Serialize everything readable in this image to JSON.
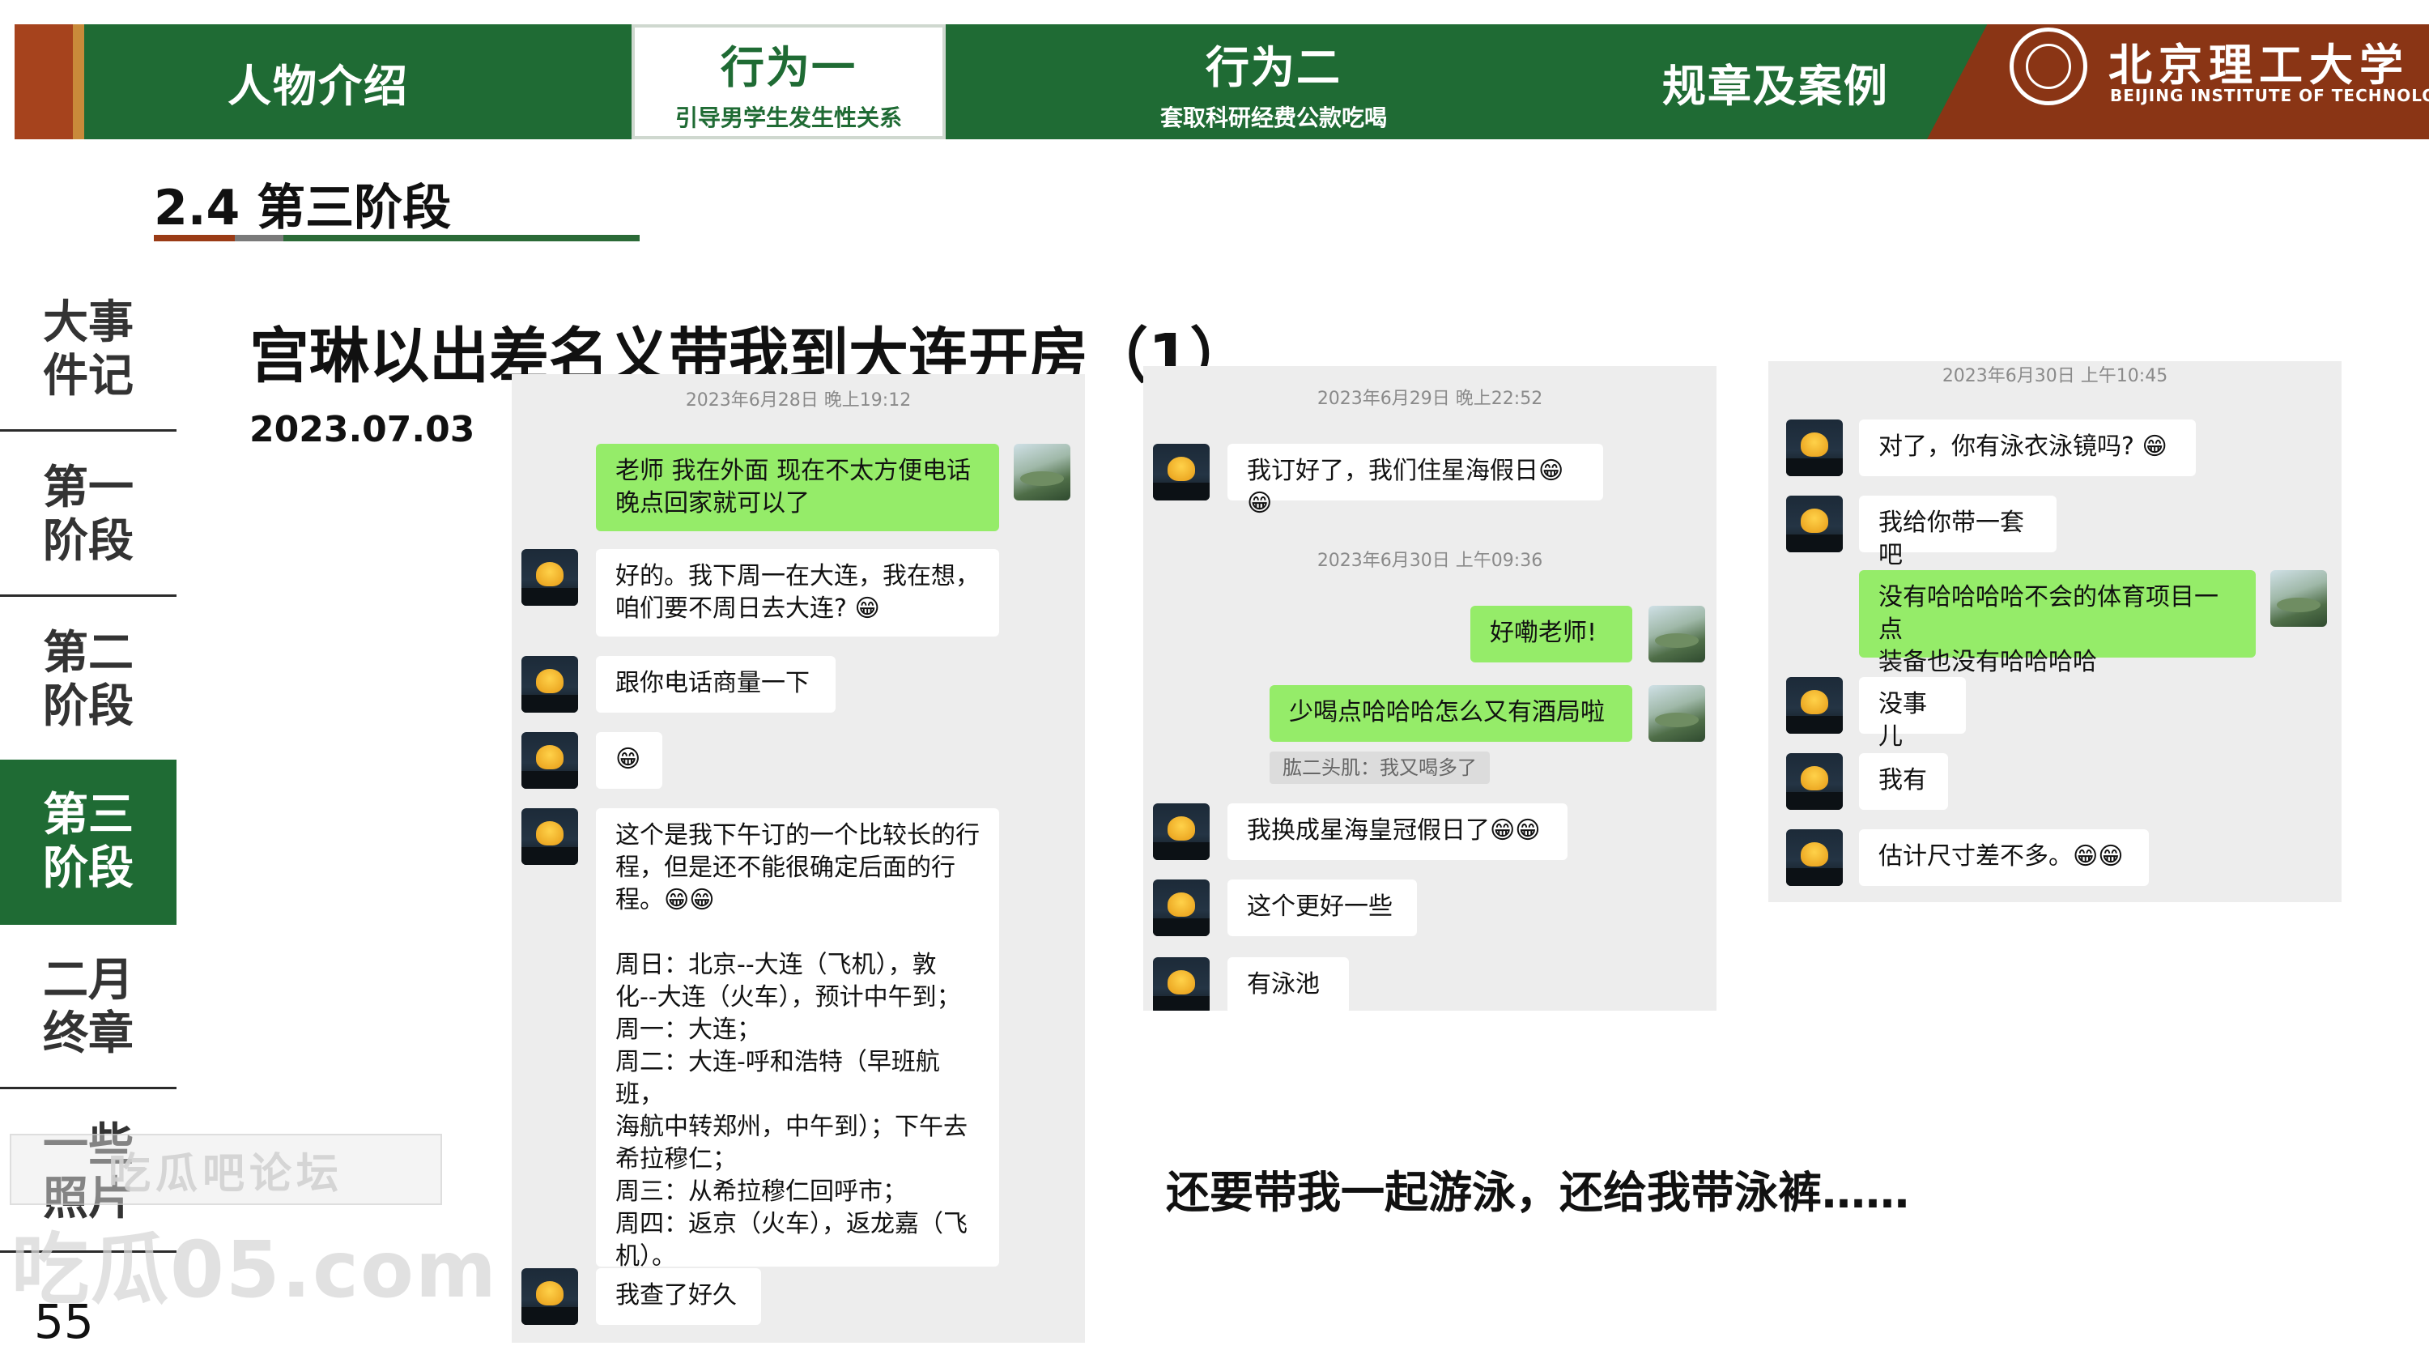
{
  "nav": {
    "tabs": [
      {
        "main": "人物介绍",
        "sub": ""
      },
      {
        "main": "行为一",
        "sub": "引导男学生发生性关系"
      },
      {
        "main": "行为二",
        "sub": "套取科研经费公款吃喝"
      },
      {
        "main": "规章及案例",
        "sub": ""
      }
    ],
    "logo_cn": "北京理工大学",
    "logo_en": "BEIJING INSTITUTE OF TECHNOLOGY"
  },
  "section_title": "2.4 第三阶段",
  "sidebar": {
    "items": [
      "大事件记",
      "第一阶段",
      "第二阶段",
      "第三阶段",
      "二月终章",
      "一些照片"
    ],
    "active_index": 3
  },
  "page_number": "55",
  "slide": {
    "title": "宫琳以出差名义带我到大连开房（1）",
    "date": "2023.07.03",
    "caption": "还要带我一起游泳，还给我带泳裤……"
  },
  "chat1": {
    "timestamp": "2023年6月28日 晚上19:12",
    "msgs": [
      "老师 我在外面 现在不太方便电话\n晚点回家就可以了",
      "好的。我下周一在大连，我在想，\n咱们要不周日去大连? 😁",
      "跟你电话商量一下",
      "😁",
      "这个是我下午订的一个比较长的行\n程，但是还不能很确定后面的行\n程。😁😁\n\n周日：北京--大连（飞机），敦\n化--大连（火车），预计中午到；\n周一：大连；\n周二：大连-呼和浩特（早班航班，\n海航中转郑州，中午到）；下午去\n希拉穆仁；\n周三：从希拉穆仁回呼市；\n周四：返京（火车），返龙嘉（飞\n机）。",
      "我查了好久"
    ]
  },
  "chat2": {
    "timestamp1": "2023年6月29日 晚上22:52",
    "timestamp2": "2023年6月30日 上午09:36",
    "msgs": [
      "我订好了，我们住星海假日😁😁",
      "好嘞老师!",
      "少喝点哈哈哈怎么又有酒局啦",
      "我换成星海皇冠假日了😁😁",
      "这个更好一些",
      "有泳池"
    ],
    "quote": "肱二头肌：我又喝多了"
  },
  "chat3": {
    "timestamp": "2023年6月30日 上午10:45",
    "msgs": [
      "对了，你有泳衣泳镜吗? 😁",
      "我给你带一套吧",
      "没有哈哈哈哈不会的体育项目一点\n装备也没有哈哈哈哈",
      "没事儿",
      "我有",
      "估计尺寸差不多。😁😁"
    ]
  },
  "watermark": {
    "line1": "吃瓜吧论坛",
    "line2": "吃瓜05.com"
  }
}
